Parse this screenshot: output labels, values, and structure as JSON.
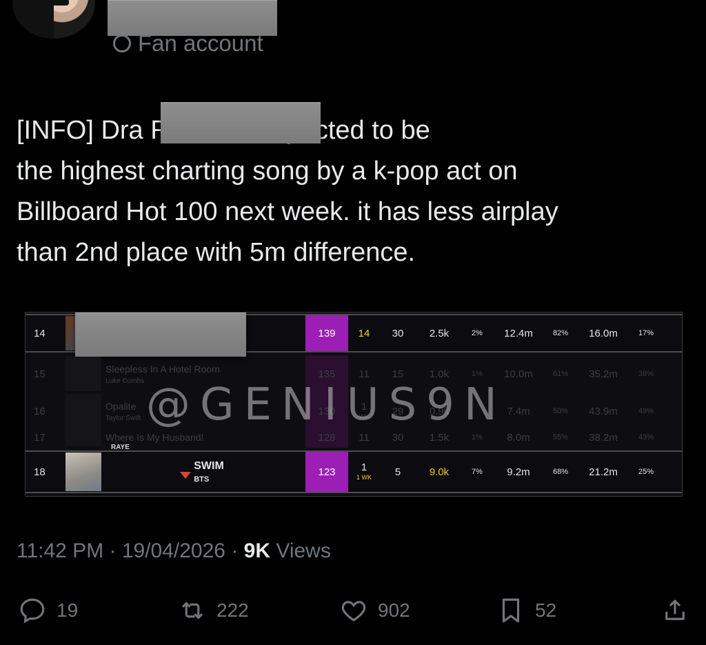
{
  "tweet": {
    "account_label": "Fan account",
    "text": "[INFO] Dra                             Remix is expected to be\nthe highest charting song by a k-pop act on\nBillboard Hot 100 next week. it has less airplay\nthan 2nd place with 5m difference.",
    "timestamp": "11:42 PM · 19/04/2026 · ",
    "views_count": "9K",
    "views_label": " Views"
  },
  "chart": {
    "watermark": "@GENIUS9N",
    "rows": [
      {
        "rank": "14",
        "title": "",
        "artist": "",
        "points": "139",
        "peak": "14",
        "weeks": "30",
        "sales": "2.5k",
        "sales_pct": "2%",
        "airplay": "12.4m",
        "airplay_pct": "82%",
        "streams": "16.0m",
        "streams_pct": "17%"
      },
      {
        "rank": "15",
        "title": "Sleepless In A Hotel Room",
        "artist": "Luke Combs",
        "points": "135",
        "peak": "11",
        "weeks": "15",
        "sales": "1.0k",
        "sales_pct": "1%",
        "airplay": "10.0m",
        "airplay_pct": "61%",
        "streams": "35.2m",
        "streams_pct": "38%"
      },
      {
        "rank": "16",
        "title": "Opalite",
        "artist": "Taylor Swift",
        "points": "130",
        "peak": "1",
        "peak_sub": "WK",
        "weeks": "29",
        "sales": "0.9k",
        "sales_pct": "",
        "airplay": "7.4m",
        "airplay_pct": "50%",
        "streams": "43.9m",
        "streams_pct": "49%"
      },
      {
        "rank": "17",
        "title": "Where Is My Husband!",
        "artist": "RAYE",
        "points": "128",
        "peak": "11",
        "weeks": "30",
        "sales": "1.5k",
        "sales_pct": "1%",
        "airplay": "8.0m",
        "airplay_pct": "55%",
        "streams": "38.2m",
        "streams_pct": "43%"
      },
      {
        "rank": "18",
        "title": "SWIM",
        "artist": "BTS",
        "points": "123",
        "peak": "1",
        "peak_sub": "1 WK",
        "weeks": "5",
        "sales": "9.0k",
        "sales_pct": "7%",
        "airplay": "9.2m",
        "airplay_pct": "68%",
        "streams": "21.2m",
        "streams_pct": "25%"
      }
    ]
  },
  "actions": {
    "replies": "19",
    "reposts": "222",
    "likes": "902",
    "bookmarks": "52"
  },
  "colors": {
    "accent_points": "#9b1fb5",
    "highlight": "#f2d01f",
    "down_arrow": "#e0452b"
  },
  "icons": [
    "reply-icon",
    "repost-icon",
    "like-icon",
    "bookmark-icon",
    "share-icon"
  ]
}
